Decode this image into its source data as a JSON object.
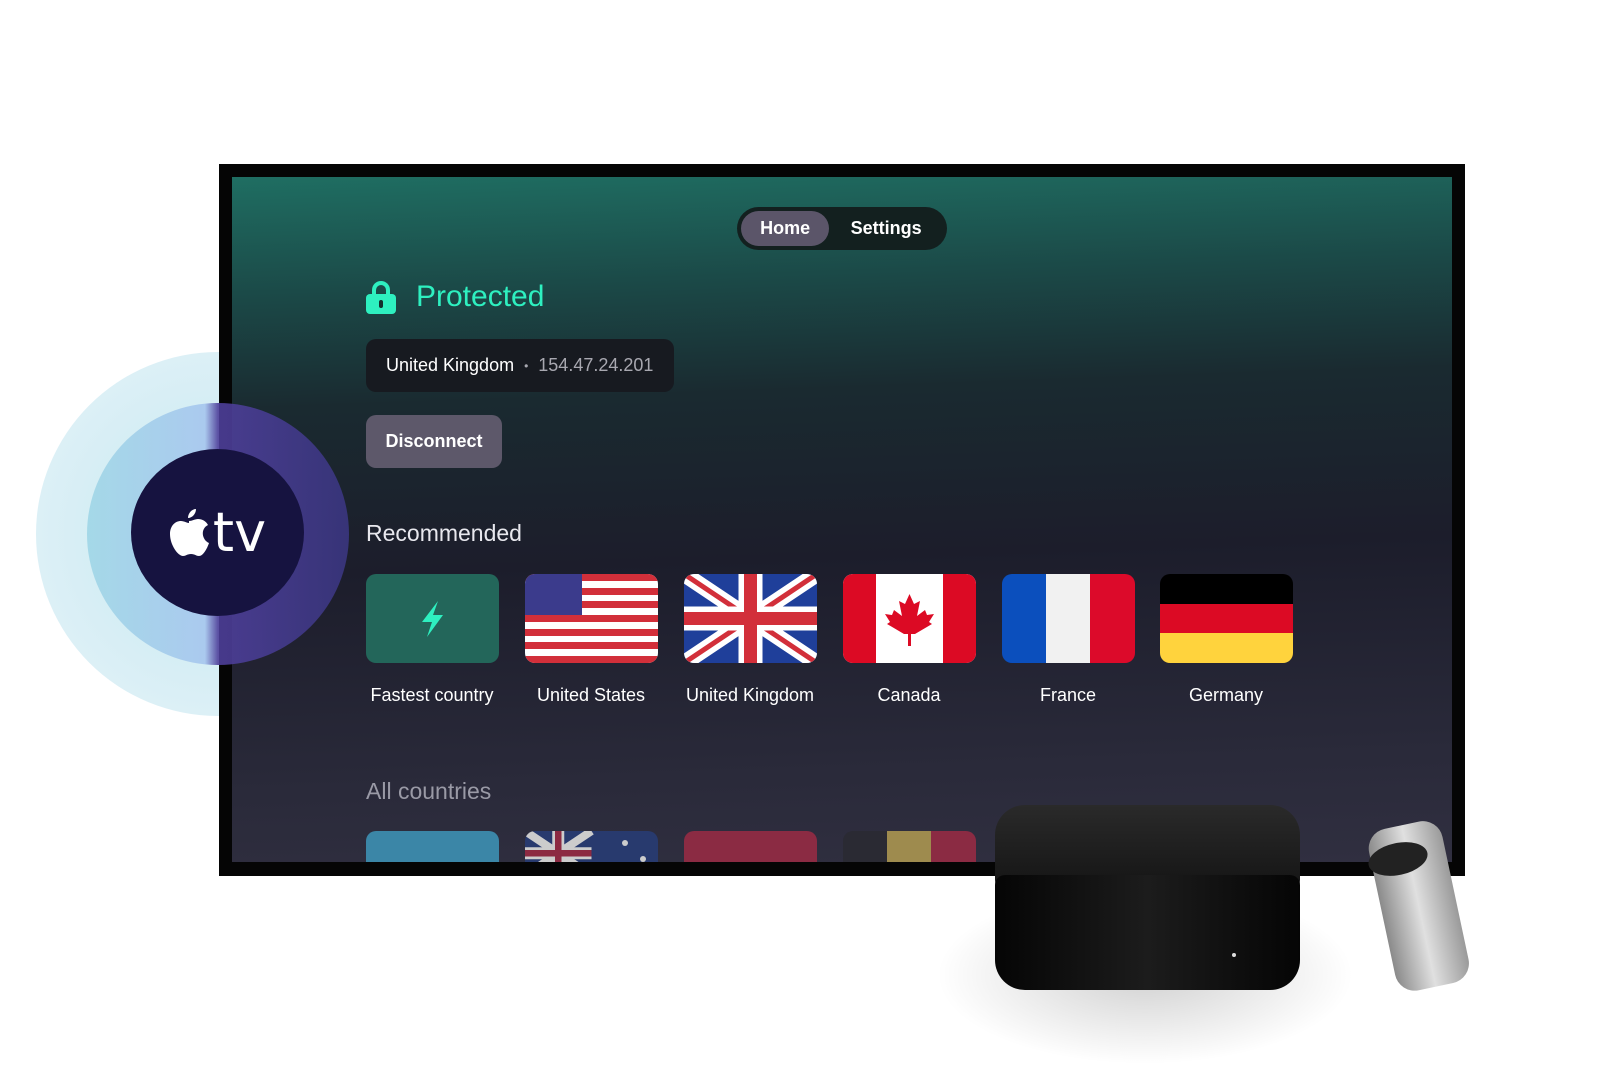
{
  "nav": {
    "tabs": [
      {
        "label": "Home",
        "active": true
      },
      {
        "label": "Settings",
        "active": false
      }
    ]
  },
  "status": {
    "label": "Protected",
    "icon": "lock-icon",
    "color": "#2ef0c0"
  },
  "connection": {
    "country": "United Kingdom",
    "separator": "•",
    "ip": "154.47.24.201"
  },
  "disconnect_label": "Disconnect",
  "recommended": {
    "title": "Recommended",
    "items": [
      {
        "label": "Fastest country",
        "icon": "lightning-icon"
      },
      {
        "label": "United States",
        "flag": "us"
      },
      {
        "label": "United Kingdom",
        "flag": "gb"
      },
      {
        "label": "Canada",
        "flag": "ca"
      },
      {
        "label": "France",
        "flag": "fr"
      },
      {
        "label": "Germany",
        "flag": "de"
      }
    ]
  },
  "all_countries": {
    "title": "All countries"
  },
  "badge": {
    "logo": "apple tv"
  }
}
